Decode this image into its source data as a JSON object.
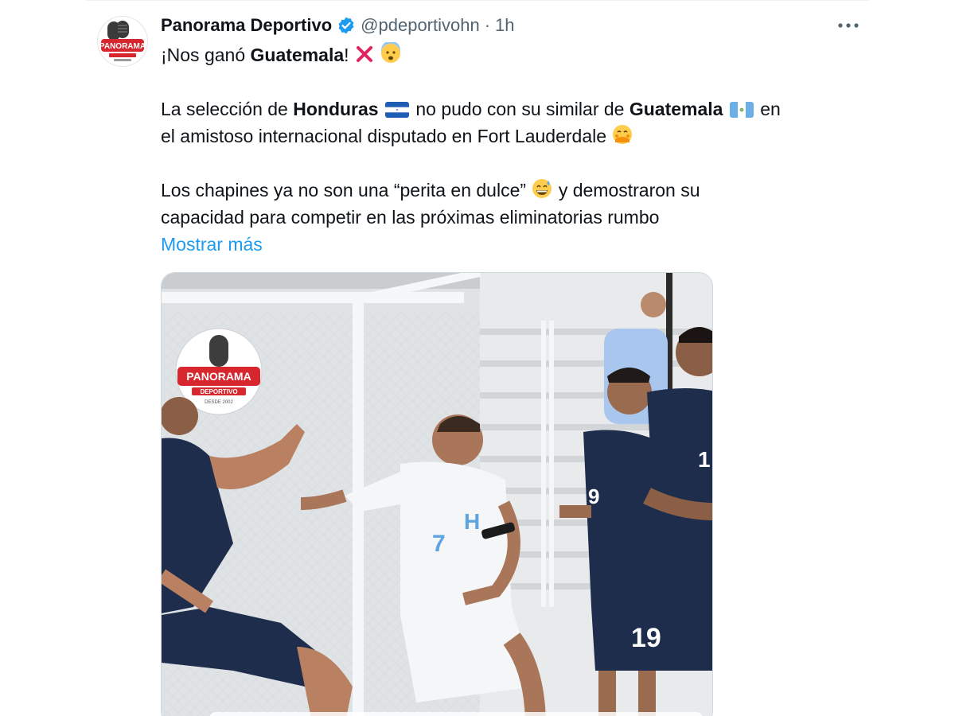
{
  "tweet": {
    "author": {
      "display_name": "Panorama Deportivo",
      "handle": "@pdeportivohn",
      "verified": true,
      "avatar_logo_text": "PANORAMA"
    },
    "separator": "·",
    "time": "1h",
    "more_icon": "more-horizontal-icon",
    "text": {
      "line1_pre": "¡Nos ganó ",
      "line1_bold": "Guatemala",
      "line1_post": "!",
      "line2_pre": "La selección de ",
      "line2_bold1": "Honduras",
      "line2_mid": " no pudo con su similar de ",
      "line2_bold2": "Guatemala",
      "line2_post": " en",
      "line3": "el amistoso internacional disputado en Fort Lauderdale ",
      "line4_pre": "Los chapines ya no son una “perita en dulce” ",
      "line4_post": " y demostraron su",
      "line5": "capacidad para competir en las próximas eliminatorias rumbo",
      "show_more": "Mostrar más"
    },
    "media": {
      "watermark": {
        "brand": "PANORAMA",
        "sub": "DEPORTIVO",
        "since": "DESDE 2002"
      },
      "jersey_numbers": [
        "7",
        "9",
        "19",
        "1"
      ],
      "chest_letter": "H"
    }
  },
  "colors": {
    "link": "#1d9bf0",
    "secondary_text": "#536471",
    "verified": "#1d9bf0",
    "brand_red": "#d7262e"
  }
}
